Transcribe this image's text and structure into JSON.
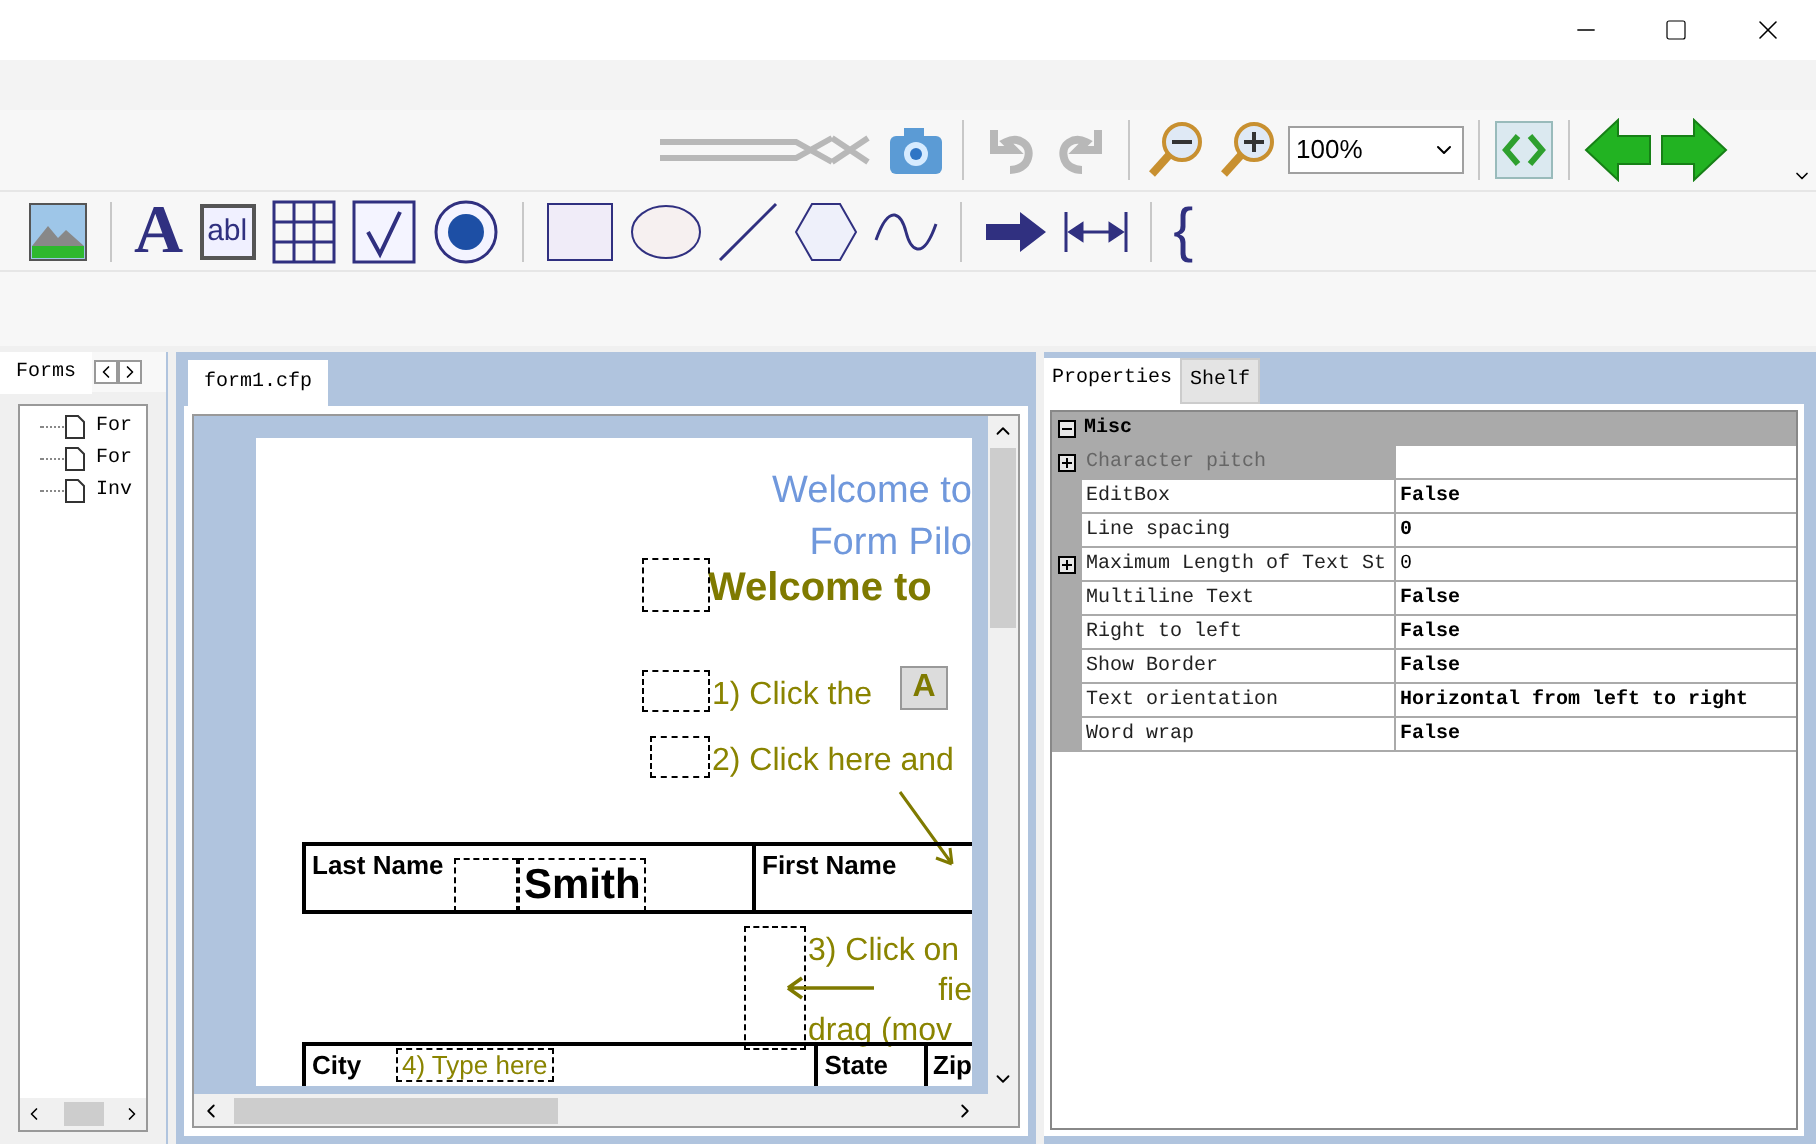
{
  "toolbar": {
    "buttons": [
      {
        "kind": "cut",
        "disabled": true
      },
      {
        "kind": "camera",
        "disabled": false
      },
      {
        "kind": "undo",
        "disabled": true
      },
      {
        "kind": "redo",
        "disabled": true
      },
      {
        "kind": "zoom-out",
        "disabled": false
      },
      {
        "kind": "zoom-in",
        "disabled": false
      }
    ],
    "zoom": "100%"
  },
  "tools": [
    {
      "kind": "image"
    },
    {
      "kind": "letter",
      "glyph": "A"
    },
    {
      "kind": "field",
      "glyph": "abl"
    },
    {
      "kind": "grid"
    },
    {
      "kind": "check"
    },
    {
      "kind": "radio"
    },
    {
      "kind": "rect"
    },
    {
      "kind": "ellipse"
    },
    {
      "kind": "line"
    },
    {
      "kind": "hexagon"
    },
    {
      "kind": "wave"
    },
    {
      "kind": "arrow"
    },
    {
      "kind": "dimension"
    },
    {
      "kind": "brace",
      "glyph": "{"
    }
  ],
  "forms_panel": {
    "tab": "Forms",
    "items": [
      "For",
      "For",
      "Inv"
    ]
  },
  "document": {
    "tab": "form1.cfp",
    "texts": [
      {
        "kind": "title",
        "text": "Welcome to"
      },
      {
        "kind": "title",
        "text": "Form Pilo"
      },
      {
        "kind": "heading",
        "text": "Welcome to"
      },
      {
        "kind": "step1",
        "text": "1) Click the"
      },
      {
        "kind": "step2",
        "text": "2) Click here and"
      },
      {
        "kind": "step3",
        "text": "3) Click on"
      },
      {
        "kind": "step3b",
        "text": "fie"
      },
      {
        "kind": "step3c",
        "text": "drag (mov"
      },
      {
        "kind": "step4",
        "text": "4) Type here"
      }
    ],
    "step1_icon": "A",
    "name_row": {
      "last_label": "Last Name",
      "last_value": "Smith",
      "first_label": "First Name"
    },
    "address_row": [
      "City",
      "State",
      "Zip"
    ]
  },
  "properties": {
    "tabs": [
      {
        "label": "Properties",
        "selected": true
      },
      {
        "label": "Shelf",
        "selected": false
      }
    ],
    "category": {
      "label": "Misc",
      "expanded": true
    },
    "rows": [
      {
        "name": "Character pitch",
        "value": "",
        "expandable": true,
        "disabled": true,
        "bold": false
      },
      {
        "name": "EditBox",
        "value": "False",
        "expandable": false,
        "disabled": false,
        "bold": true
      },
      {
        "name": "Line spacing",
        "value": "0",
        "expandable": false,
        "disabled": false,
        "bold": true
      },
      {
        "name": "Maximum Length of Text St",
        "value": "0",
        "expandable": true,
        "disabled": false,
        "bold": false
      },
      {
        "name": "Multiline Text",
        "value": "False",
        "expandable": false,
        "disabled": false,
        "bold": true
      },
      {
        "name": "Right to left",
        "value": "False",
        "expandable": false,
        "disabled": false,
        "bold": true
      },
      {
        "name": "Show Border",
        "value": "False",
        "expandable": false,
        "disabled": false,
        "bold": true
      },
      {
        "name": "Text orientation",
        "value": "Horizontal from left to right",
        "expandable": false,
        "disabled": false,
        "bold": true
      },
      {
        "name": "Word wrap",
        "value": "False",
        "expandable": false,
        "disabled": false,
        "bold": true
      }
    ]
  }
}
